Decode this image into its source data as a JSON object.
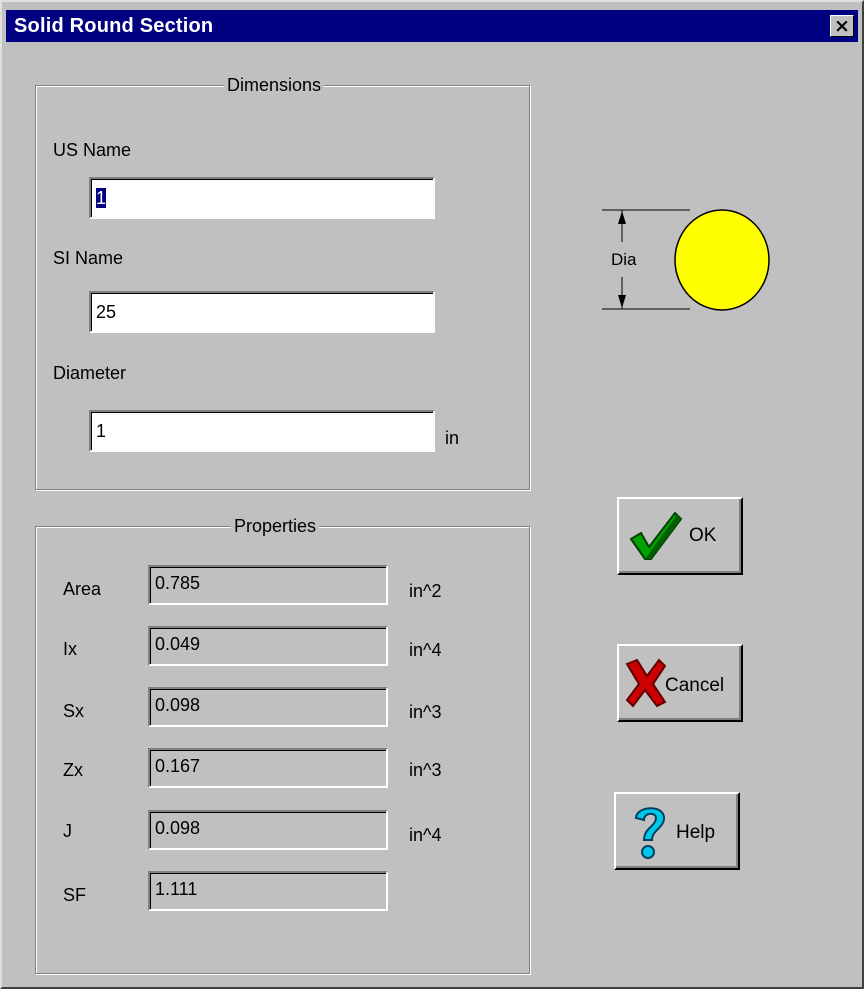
{
  "window": {
    "title": "Solid Round Section",
    "close_glyph": "×"
  },
  "dimensions": {
    "legend": "Dimensions",
    "us_name": {
      "label": "US Name",
      "value": "1"
    },
    "si_name": {
      "label": "SI Name",
      "value": "25"
    },
    "diameter": {
      "label": "Diameter",
      "value": "1",
      "unit": "in"
    }
  },
  "properties": {
    "legend": "Properties",
    "rows": [
      {
        "label": "Area",
        "value": "0.785",
        "unit": "in^2"
      },
      {
        "label": "Ix",
        "value": "0.049",
        "unit": "in^4"
      },
      {
        "label": "Sx",
        "value": "0.098",
        "unit": "in^3"
      },
      {
        "label": "Zx",
        "value": "0.167",
        "unit": "in^3"
      },
      {
        "label": "J",
        "value": "0.098",
        "unit": "in^4"
      },
      {
        "label": "SF",
        "value": "1.111",
        "unit": ""
      }
    ]
  },
  "diagram": {
    "dim_label": "Dia",
    "fill_color": "#ffff00"
  },
  "buttons": {
    "ok": {
      "label": "OK",
      "icon": "checkmark-icon"
    },
    "cancel": {
      "label": "Cancel",
      "icon": "red-x-icon"
    },
    "help": {
      "label": "Help",
      "icon": "question-mark-icon"
    }
  }
}
